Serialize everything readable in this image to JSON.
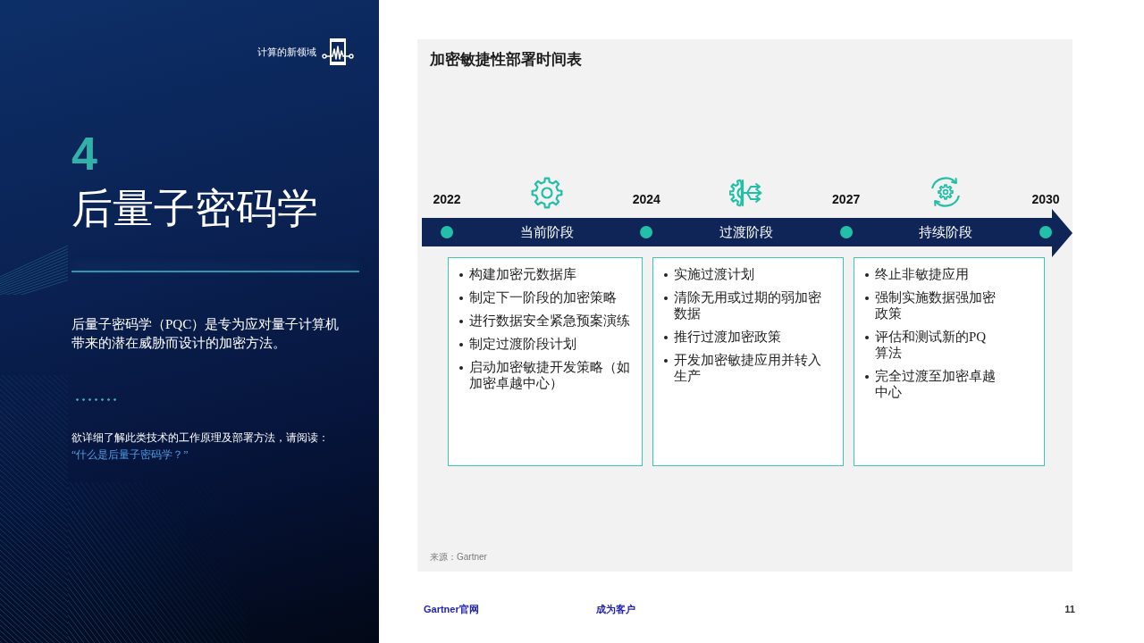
{
  "sidebar": {
    "header": "计算的新领域",
    "section_number": "4",
    "title": "后量子密码学",
    "description": "后量子密码学（PQC）是专为应对量子计算机带来的潜在威胁而设计的加密方法。",
    "read_more": "欲详细了解此类技术的工作原理及部署方法，请阅读：",
    "link": "“什么是后量子密码学？”"
  },
  "timeline": {
    "title": "加密敏捷性部署时间表",
    "years": [
      "2022",
      "2024",
      "2027",
      "2030"
    ],
    "phases": [
      {
        "label": "当前阶段",
        "items": [
          "构建加密元数据库",
          "制定下一阶段的加密策略",
          "进行数据安全紧急预案演练",
          "制定过渡阶段计划",
          "启动加密敏捷开发策略（如加密卓越中心）"
        ]
      },
      {
        "label": "过渡阶段",
        "items": [
          "实施过渡计划",
          "清除无用或过期的弱加密数据",
          "推行过渡加密政策",
          "开发加密敏捷应用并转入生产"
        ]
      },
      {
        "label": "持续阶段",
        "items": [
          "终止非敏捷应用",
          "强制实施数据强加密政策",
          "评估和测试新的PQ算法",
          "完全过渡至加密卓越中心"
        ]
      }
    ],
    "source": "来源：Gartner"
  },
  "footer": {
    "links": [
      "Gartner官网",
      "成为客户"
    ],
    "page_number": "11"
  }
}
